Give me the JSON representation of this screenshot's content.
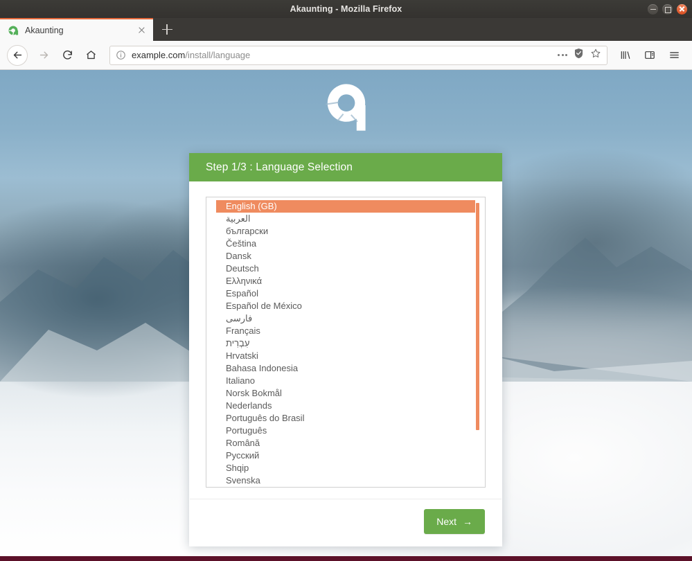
{
  "window": {
    "title": "Akaunting - Mozilla Firefox",
    "controls": {
      "minimize": "minimize-button",
      "maximize": "maximize-button",
      "close": "close-button"
    }
  },
  "browser": {
    "tab": {
      "title": "Akaunting",
      "favicon": "akaunting-logo-icon",
      "close_label": "close-tab-icon"
    },
    "new_tab_label": "+",
    "nav": {
      "back": "back-arrow-icon",
      "forward": "forward-arrow-icon",
      "reload": "reload-icon",
      "home": "home-icon"
    },
    "url": {
      "host": "example.com",
      "path": "/install/language",
      "full": "example.com/install/language",
      "identity_icon": "info-circle-icon"
    },
    "url_actions": {
      "page_actions": "ellipsis-icon",
      "tracking_protection": "shield-icon",
      "bookmark": "star-icon"
    },
    "toolbar": {
      "library": "library-icon",
      "sidebar": "sidebar-icon",
      "menu": "hamburger-menu-icon"
    }
  },
  "page": {
    "logo_alt": "akaunting-logo",
    "card": {
      "header_title": "Step 1/3 : Language Selection",
      "next_label": "Next",
      "next_arrow": "→"
    },
    "languages": [
      {
        "label": "English (GB)",
        "selected": true,
        "rtl": false
      },
      {
        "label": "العربية",
        "selected": false,
        "rtl": true
      },
      {
        "label": "български",
        "selected": false,
        "rtl": false
      },
      {
        "label": "Čeština",
        "selected": false,
        "rtl": false
      },
      {
        "label": "Dansk",
        "selected": false,
        "rtl": false
      },
      {
        "label": "Deutsch",
        "selected": false,
        "rtl": false
      },
      {
        "label": "Ελληνικά",
        "selected": false,
        "rtl": false
      },
      {
        "label": "Español",
        "selected": false,
        "rtl": false
      },
      {
        "label": "Español de México",
        "selected": false,
        "rtl": false
      },
      {
        "label": "فارسی",
        "selected": false,
        "rtl": true
      },
      {
        "label": "Français",
        "selected": false,
        "rtl": false
      },
      {
        "label": "עִבְרִית",
        "selected": false,
        "rtl": true
      },
      {
        "label": "Hrvatski",
        "selected": false,
        "rtl": false
      },
      {
        "label": "Bahasa Indonesia",
        "selected": false,
        "rtl": false
      },
      {
        "label": "Italiano",
        "selected": false,
        "rtl": false
      },
      {
        "label": "Norsk Bokmål",
        "selected": false,
        "rtl": false
      },
      {
        "label": "Nederlands",
        "selected": false,
        "rtl": false
      },
      {
        "label": "Português do Brasil",
        "selected": false,
        "rtl": false
      },
      {
        "label": "Português",
        "selected": false,
        "rtl": false
      },
      {
        "label": "Română",
        "selected": false,
        "rtl": false
      },
      {
        "label": "Русский",
        "selected": false,
        "rtl": false
      },
      {
        "label": "Shqip",
        "selected": false,
        "rtl": false
      },
      {
        "label": "Svenska",
        "selected": false,
        "rtl": false
      }
    ]
  },
  "colors": {
    "header_green": "#6aab4a",
    "accent_orange": "#ef8b5f",
    "tab_accent": "#e66a3c",
    "titlebar": "#3b3936",
    "bottom_strip": "#5c1129"
  }
}
